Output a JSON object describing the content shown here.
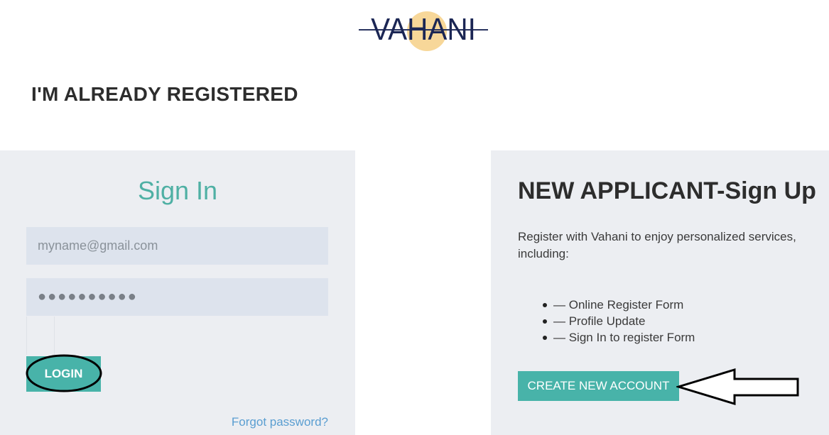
{
  "brand": {
    "logo_text": "VAHANI",
    "sun_color": "#f7d799",
    "text_color": "#1b2654"
  },
  "header": {
    "title": "I'M ALREADY REGISTERED"
  },
  "signin": {
    "title": "Sign In",
    "email_placeholder": "myname@gmail.com",
    "password_value": "●●●●●●●●●●",
    "login_label": "LOGIN",
    "forgot_label": "Forgot password?"
  },
  "signup": {
    "title": "NEW APPLICANT-Sign Up",
    "description": "Register with Vahani to enjoy personalized services, including:",
    "benefits": [
      "— Online Register Form",
      "— Profile Update",
      "— Sign In to register Form"
    ],
    "create_label": "CREATE NEW ACCOUNT"
  },
  "colors": {
    "accent": "#48b3a9",
    "title_teal": "#4fb0a4",
    "panel_bg": "#eceef2",
    "field_bg": "#dde3ed",
    "link": "#5a9ed1"
  },
  "annotations": {
    "login_circle": "ellipse",
    "create_arrow": "arrow-left"
  }
}
